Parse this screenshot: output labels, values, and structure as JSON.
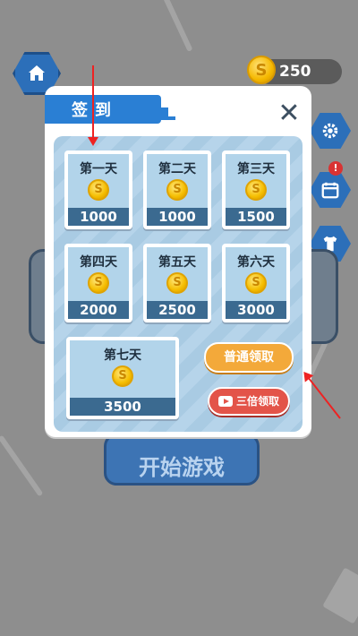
{
  "top_bar": {
    "coin_count": "250",
    "coin_symbol": "S"
  },
  "background": {
    "start_button_label": "开始游戏",
    "alert_badge": "!"
  },
  "dialog": {
    "title": "签到",
    "close_symbol": "✕",
    "days": [
      {
        "label": "第一天",
        "amount": "1000"
      },
      {
        "label": "第二天",
        "amount": "1000"
      },
      {
        "label": "第三天",
        "amount": "1500"
      },
      {
        "label": "第四天",
        "amount": "2000"
      },
      {
        "label": "第五天",
        "amount": "2500"
      },
      {
        "label": "第六天",
        "amount": "3000"
      },
      {
        "label": "第七天",
        "amount": "3500"
      }
    ],
    "coin_symbol": "S",
    "normal_claim_label": "普通领取",
    "triple_claim_label": "三倍领取"
  },
  "colors": {
    "accent_blue": "#2a7fd4",
    "orange_button": "#f3a93a",
    "red_button": "#e35449",
    "annotation_arrow": "#e22"
  }
}
